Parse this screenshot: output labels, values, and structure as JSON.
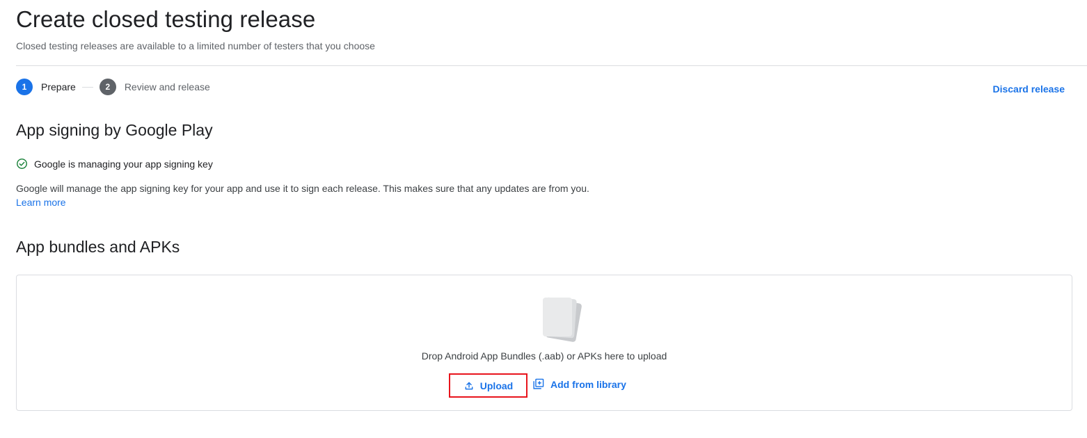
{
  "header": {
    "title": "Create closed testing release",
    "subtitle": "Closed testing releases are available to a limited number of testers that you choose"
  },
  "stepper": {
    "steps": [
      {
        "number": "1",
        "label": "Prepare",
        "state": "active"
      },
      {
        "number": "2",
        "label": "Review and release",
        "state": "inactive"
      }
    ],
    "discard_label": "Discard release"
  },
  "app_signing": {
    "title": "App signing by Google Play",
    "status_icon": "check-circle-icon",
    "status_text": "Google is managing your app signing key",
    "description": "Google will manage the app signing key for your app and use it to sign each release. This makes sure that any updates are from you.",
    "learn_more_label": "Learn more"
  },
  "bundles": {
    "title": "App bundles and APKs",
    "drop_text": "Drop Android App Bundles (.aab) or APKs here to upload",
    "upload_label": "Upload",
    "upload_icon": "upload-icon",
    "library_label": "Add from library",
    "library_icon": "add-library-icon"
  },
  "colors": {
    "accent": "#1a73e8",
    "success": "#188038",
    "highlight_border": "#e8141c"
  }
}
